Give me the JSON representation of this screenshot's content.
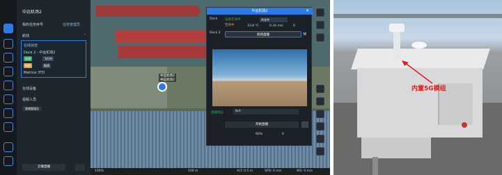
{
  "panel": {
    "title": "中远机场2",
    "task_label": "我的任务序号",
    "task_manage": "任务管理员",
    "section_plan": "航线",
    "status_card": "在线状态",
    "dock_name": "Dock 2 - 中远机场2",
    "dock_tag1": "在线",
    "dock_tag2": "飞行中",
    "drone_tag": "待机",
    "drone_tag2": "航线",
    "drone_name": "Matrice 3TD",
    "online_devices": "在线设备",
    "video_people": "视频人员",
    "person_chip": "视频管理员",
    "bottom_btn": "云端直播",
    "collapse_symbol": "⌃"
  },
  "video": {
    "title": "中远机场2",
    "side_label": "Dock",
    "dock_id": "Dock 2",
    "status_line1": "设备在线中",
    "status_line2": "空闲中",
    "badge_status": "作业中",
    "metric_temp": "33.8 ℃",
    "metric_wind": "0.34 m/s",
    "metric_rain": "0",
    "metric_label": "机场状态",
    "action_button": "机场直播",
    "field_label": "直播状态",
    "field_value": "N/A",
    "live_button": "开始直播",
    "battery": "90%",
    "signal": "0"
  },
  "map": {
    "marker_main": "中远机场2",
    "marker_sub": "中远机场2",
    "scale": "100 m",
    "zoom": "100%",
    "coords": "ALT: 0.5 m",
    "speed": "SPD: 0 m/s",
    "wind": "WS: 0 m/s"
  },
  "photo": {
    "callout": "内置5G模组"
  },
  "colors": {
    "accent": "#2c7be5",
    "online": "#2fae5f",
    "warn": "#e8a33a",
    "callout": "#e02020"
  }
}
